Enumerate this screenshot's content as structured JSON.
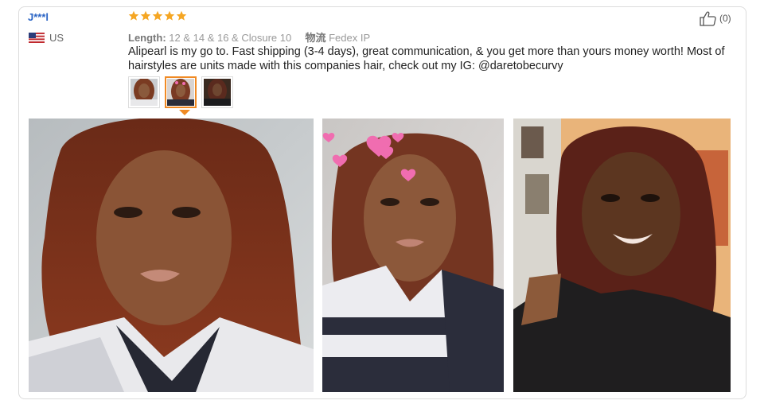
{
  "reviewer": {
    "name": "J***l",
    "country": "US"
  },
  "rating": {
    "stars": 5,
    "max": 5,
    "color": "#f5a623"
  },
  "attributes": [
    {
      "key": "Length:",
      "value": "12 & 14 & 16 & Closure 10"
    },
    {
      "key": "物流",
      "value": "Fedex IP"
    }
  ],
  "review_text": "Alipearl is my go to. Fast shipping (3-4 days), great communication, & you get more than yours money worth! Most of hairstyles are units made with this companies hair, check out my IG: @daretobecurvy",
  "helpful": {
    "count_label": "(0)",
    "icon": "thumbs-up-icon"
  },
  "thumbnails": {
    "count": 3,
    "selected_index": 1,
    "highlight_color": "#f08a24"
  },
  "photos": {
    "count": 3
  }
}
